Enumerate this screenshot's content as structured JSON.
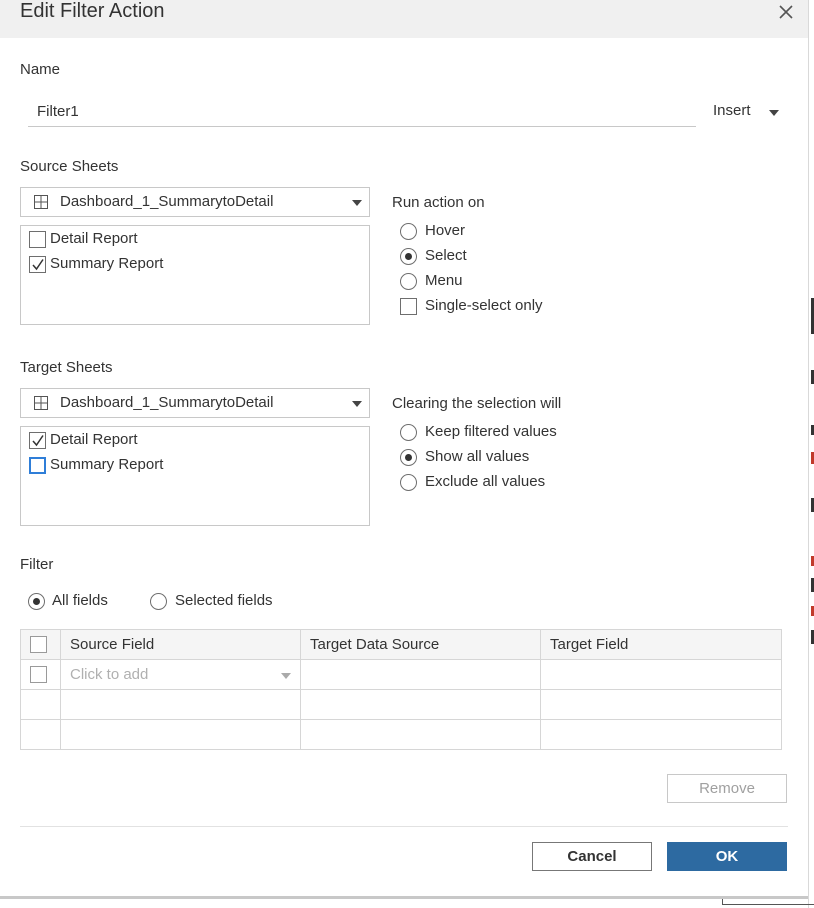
{
  "dialog": {
    "title": "Edit Filter Action",
    "name_label": "Name",
    "name_value": "Filter1",
    "insert_label": "Insert"
  },
  "source": {
    "section_label": "Source Sheets",
    "dropdown_value": "Dashboard_1_SummarytoDetail",
    "items": [
      {
        "label": "Detail Report",
        "checked": false
      },
      {
        "label": "Summary Report",
        "checked": true
      }
    ]
  },
  "run_action": {
    "label": "Run action on",
    "options": [
      {
        "label": "Hover",
        "selected": false
      },
      {
        "label": "Select",
        "selected": true
      },
      {
        "label": "Menu",
        "selected": false
      }
    ],
    "single_select_label": "Single-select only",
    "single_select_checked": false
  },
  "target": {
    "section_label": "Target Sheets",
    "dropdown_value": "Dashboard_1_SummarytoDetail",
    "items": [
      {
        "label": "Detail Report",
        "checked": true
      },
      {
        "label": "Summary Report",
        "checked": false
      }
    ]
  },
  "clearing": {
    "label": "Clearing the selection will",
    "options": [
      {
        "label": "Keep filtered values",
        "selected": false
      },
      {
        "label": "Show all values",
        "selected": true
      },
      {
        "label": "Exclude all values",
        "selected": false
      }
    ]
  },
  "filter": {
    "section_label": "Filter",
    "all_fields_label": "All fields",
    "selected_fields_label": "Selected fields",
    "mode": "all",
    "columns": [
      "Source Field",
      "Target Data Source",
      "Target Field"
    ],
    "add_placeholder": "Click to add"
  },
  "buttons": {
    "remove": "Remove",
    "cancel": "Cancel",
    "ok": "OK"
  },
  "colors": {
    "accent": "#2d6aa1",
    "focus": "#2f7ed8"
  }
}
